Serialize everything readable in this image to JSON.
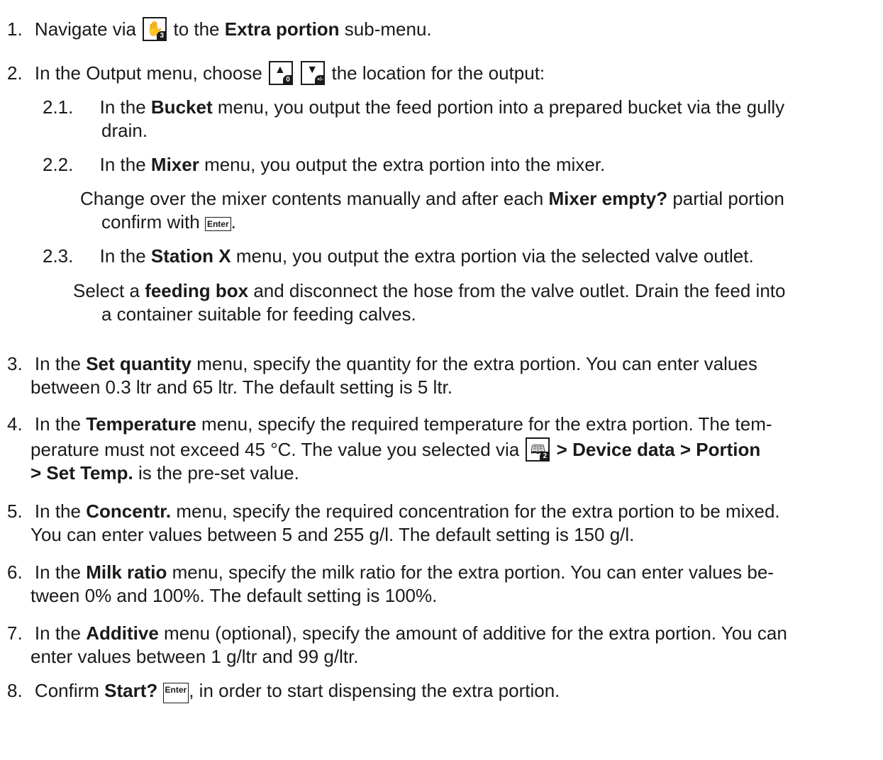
{
  "steps": [
    {
      "num": "1.",
      "l1a": "Navigate via",
      "key": "hand-icon",
      "sub": "3",
      "l1b": "to the",
      "l1c": "Extra portion",
      "l1d": "sub-menu."
    },
    {
      "num": "2.",
      "l1a": "In the Output menu, choose",
      "sub_up": "0",
      "sub_down": "+/-",
      "l1b": "the location for the output:",
      "subs": [
        {
          "num": "2.1.",
          "a": "In the",
          "b": "Bucket",
          "c": "menu, you output the feed portion into a prepared bucket via the gully",
          "d": "drain."
        },
        {
          "num": "2.2.",
          "a": "In the",
          "b": "Mixer",
          "c": "menu, you output the extra portion into the mixer."
        },
        {
          "note_a": "Change over the mixer contents manually and after each",
          "note_b": "Mixer empty?",
          "note_c": "partial portion",
          "note_d": "confirm with",
          "enter": "Enter",
          "note_e": "."
        },
        {
          "num": "2.3.",
          "a": "In the",
          "b": "Station X",
          "c": "menu, you output the extra portion via the selected valve outlet."
        },
        {
          "note_a": "Select a",
          "note_b": "feeding box",
          "note_c": "and disconnect the hose from the valve outlet. Drain the feed into",
          "note_d": "a container suitable for feeding calves."
        }
      ]
    },
    {
      "num": "3.",
      "a": "In the",
      "b": "Set quantity",
      "c": "menu, specify the quantity for the extra portion. You can enter values",
      "d": "between 0.3 ltr and 65 ltr. The default setting is 5 ltr."
    },
    {
      "num": "4.",
      "a": "In the",
      "b": "Temperature",
      "c": "menu, specify the required temperature for the extra portion. The tem-",
      "d": "perature must not exceed 45 °C. The value you selected via",
      "sub": "2",
      "e": "> Device data > Portion",
      "f": "> Set Temp.",
      "g": "is the pre-set value."
    },
    {
      "num": "5.",
      "a": "In the",
      "b": "Concentr.",
      "c": "menu, specify the required concentration for the extra portion to be mixed.",
      "d": "You can enter values between 5 and 255 g/l. The default setting is 150 g/l."
    },
    {
      "num": "6.",
      "a": "In the",
      "b": "Milk ratio",
      "c": "menu, specify the milk ratio for the extra portion. You can enter values be-",
      "d": "tween 0% and 100%. The default setting is 100%."
    },
    {
      "num": "7.",
      "a": "In the",
      "b": "Additive",
      "c": "menu (optional), specify the amount of additive for the extra portion. You can",
      "d": "enter values between 1 g/ltr and 99 g/ltr."
    },
    {
      "num": "8.",
      "a": "Confirm",
      "b": "Start?",
      "enter": "Enter",
      "c": ", in order to start dispensing the extra portion."
    }
  ]
}
